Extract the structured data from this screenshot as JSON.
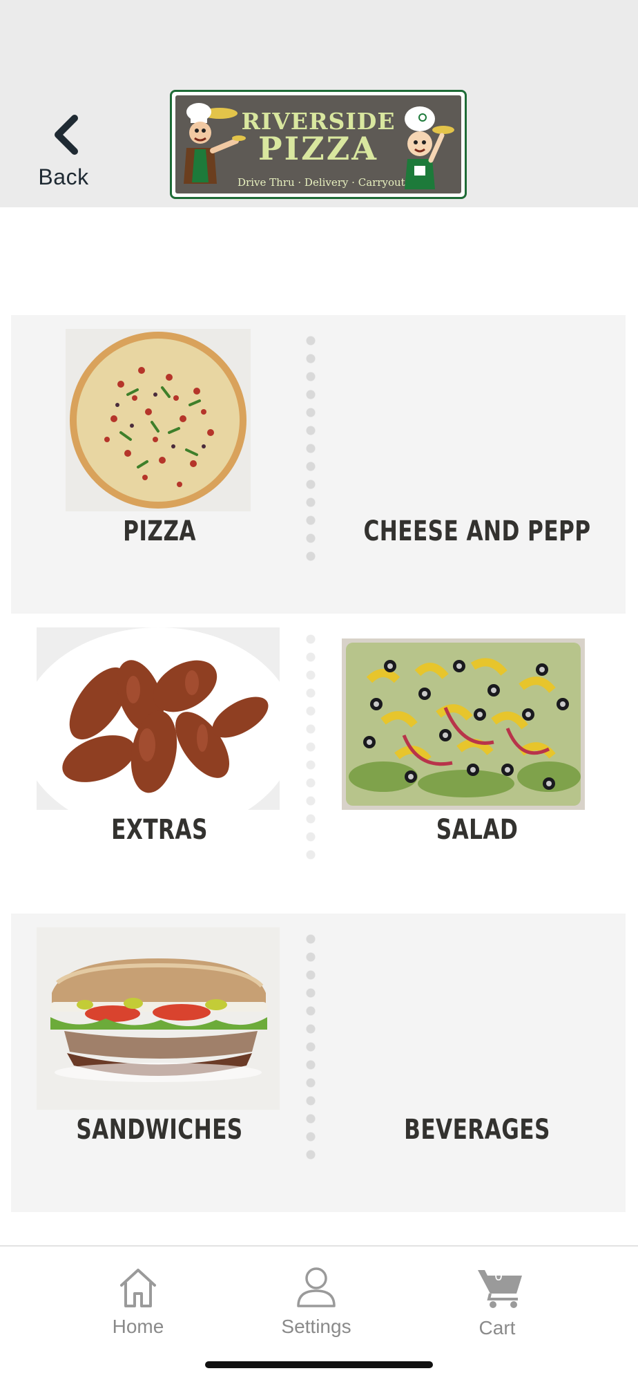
{
  "header": {
    "back_label": "Back",
    "logo": {
      "line1": "RIVERSIDE",
      "line2": "PIZZA",
      "tagline": "Drive Thru · Delivery · Carryout"
    }
  },
  "categories": [
    {
      "label": "PIZZA",
      "image": "pizza-photo"
    },
    {
      "label": "CHEESE AND PEPP",
      "image": null
    },
    {
      "label": "EXTRAS",
      "image": "chicken-wings-photo"
    },
    {
      "label": "SALAD",
      "image": "salad-photo"
    },
    {
      "label": "SANDWICHES",
      "image": "sandwich-photo"
    },
    {
      "label": "BEVERAGES",
      "image": null
    }
  ],
  "tabbar": {
    "home_label": "Home",
    "settings_label": "Settings",
    "cart_label": "Cart",
    "cart_count": "0"
  },
  "colors": {
    "header_bg": "#ebebeb",
    "logo_border": "#1e6b36",
    "logo_bg": "#5e5a55",
    "logo_text": "#d9e79f",
    "row_shade": "#f4f4f4",
    "category_text": "#33322f",
    "tab_text": "#8a8a8a"
  }
}
